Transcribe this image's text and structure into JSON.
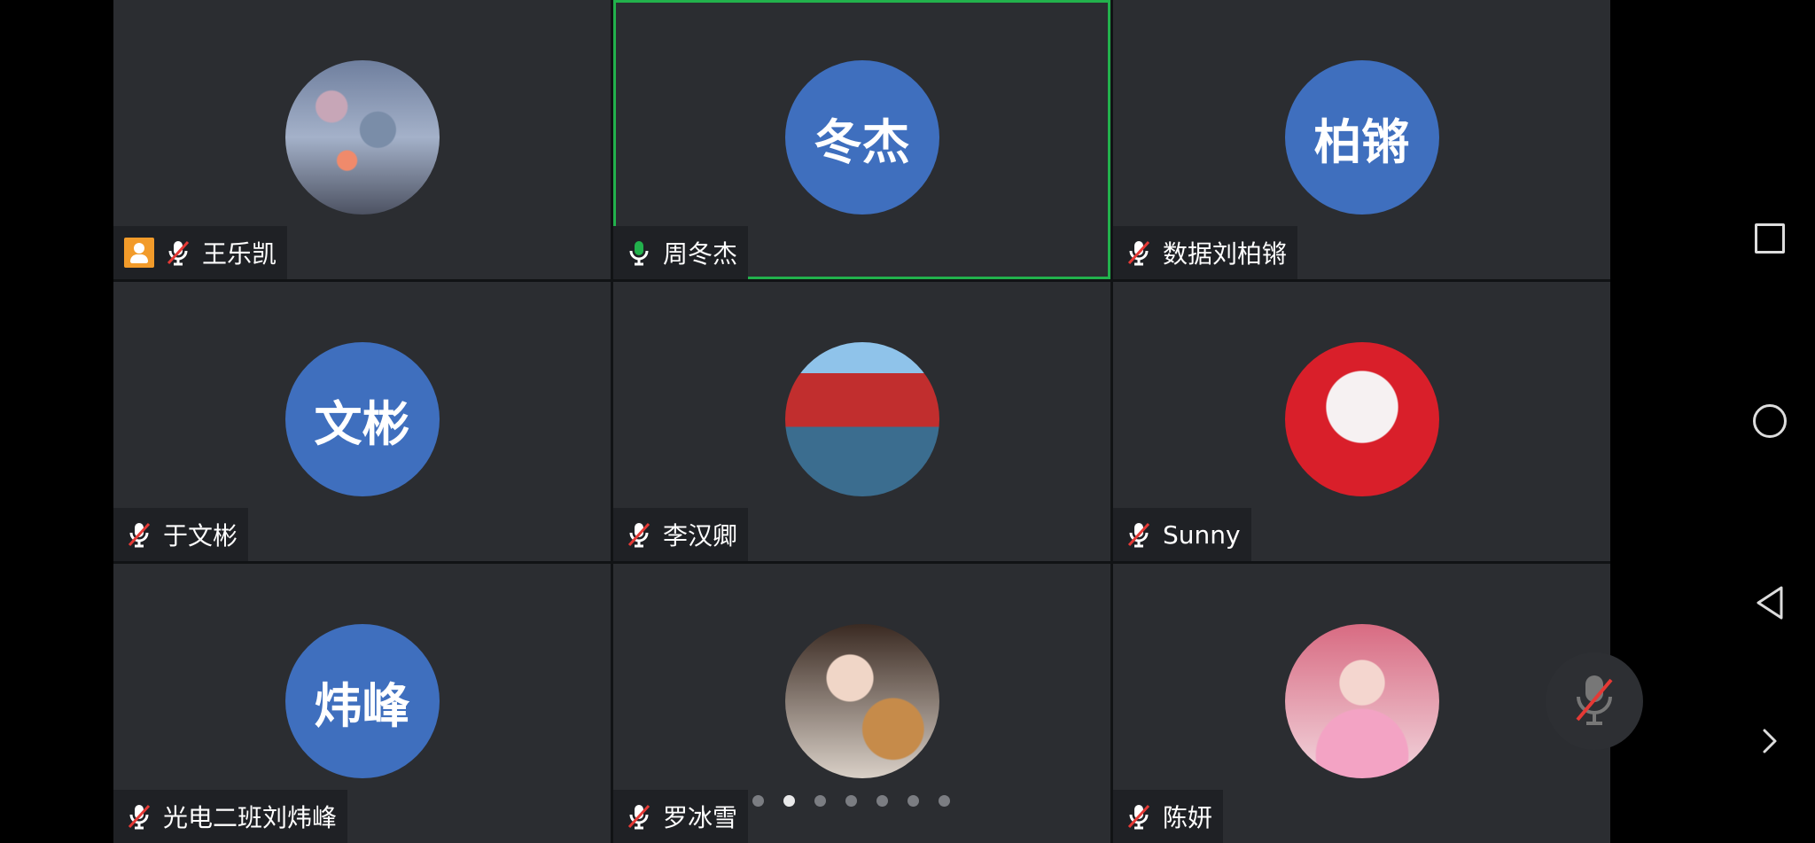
{
  "participants": [
    {
      "name": "王乐凯",
      "avatar_type": "photo",
      "avatar_style": "sky",
      "mic": "muted",
      "host_badge": true,
      "speaking": false
    },
    {
      "name": "周冬杰",
      "avatar_type": "text",
      "avatar_text": "冬杰",
      "mic": "on",
      "host_badge": false,
      "speaking": true
    },
    {
      "name": "数据刘柏锵",
      "avatar_type": "text",
      "avatar_text": "柏锵",
      "mic": "muted",
      "host_badge": false,
      "speaking": false
    },
    {
      "name": "于文彬",
      "avatar_type": "text",
      "avatar_text": "文彬",
      "mic": "muted",
      "host_badge": false,
      "speaking": false
    },
    {
      "name": "李汉卿",
      "avatar_type": "photo",
      "avatar_style": "gate",
      "mic": "muted",
      "host_badge": false,
      "speaking": false
    },
    {
      "name": "Sunny",
      "avatar_type": "photo",
      "avatar_style": "anime",
      "mic": "muted",
      "host_badge": false,
      "speaking": false
    },
    {
      "name": "光电二班刘炜峰",
      "avatar_type": "text",
      "avatar_text": "炜峰",
      "mic": "muted",
      "host_badge": false,
      "speaking": false
    },
    {
      "name": "罗冰雪",
      "avatar_type": "photo",
      "avatar_style": "dog",
      "mic": "muted",
      "host_badge": false,
      "speaking": false
    },
    {
      "name": "陈妍",
      "avatar_type": "photo",
      "avatar_style": "portrait",
      "mic": "muted",
      "host_badge": false,
      "speaking": false
    }
  ],
  "pagination": {
    "pages": 7,
    "current_page": 2
  },
  "icons": {
    "host_badge": "person-icon",
    "muted_mic": "mic-off-icon",
    "active_mic": "mic-icon",
    "system_buttons": [
      "square-icon",
      "circle-icon",
      "back-icon",
      "chevron-right-icon"
    ]
  },
  "colors": {
    "tile_background": "#2b2d31",
    "avatar_blue": "#3f6fbe",
    "speaking_green": "#22b14c",
    "muted_red": "#e53935"
  }
}
